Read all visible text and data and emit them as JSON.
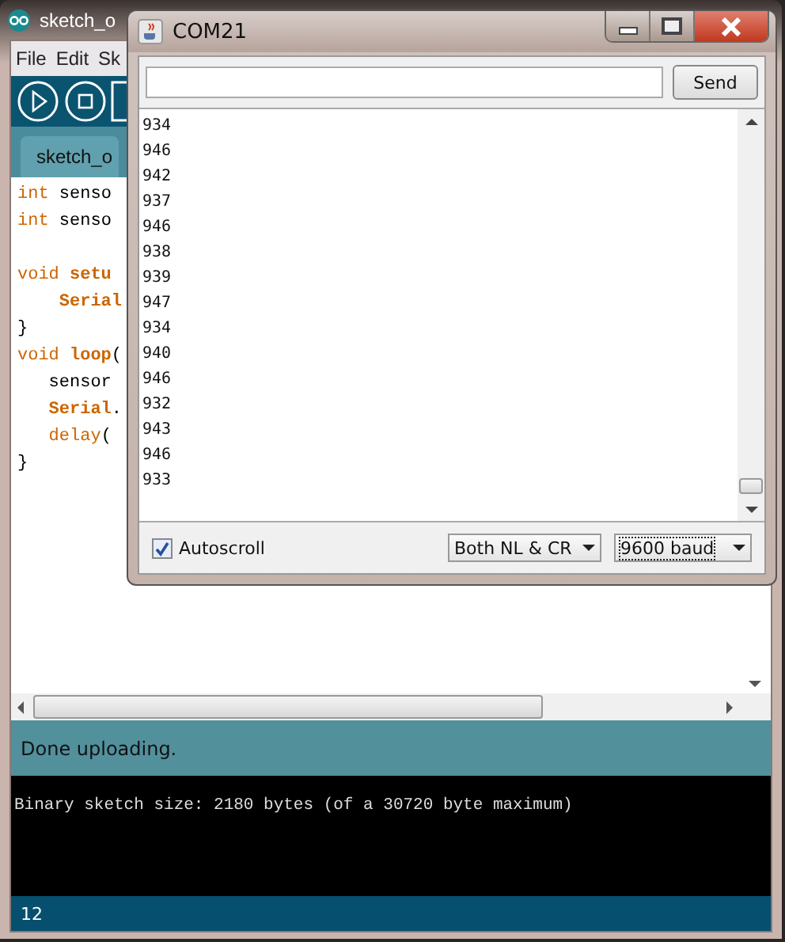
{
  "editor_window": {
    "title": "sketch_o",
    "menu": [
      {
        "label": "File"
      },
      {
        "label": "Edit"
      },
      {
        "label": "Sk"
      }
    ],
    "tab": {
      "label": "sketch_o"
    },
    "code_lines": [
      {
        "tokens": [
          {
            "kind": "keyword",
            "text": "int"
          },
          {
            "kind": "plain",
            "text": " senso"
          }
        ]
      },
      {
        "tokens": [
          {
            "kind": "keyword",
            "text": "int"
          },
          {
            "kind": "plain",
            "text": " senso"
          }
        ]
      },
      {
        "gap_before": true,
        "tokens": [
          {
            "kind": "keyword",
            "text": "void"
          },
          {
            "kind": "bold",
            "text": " setu"
          }
        ]
      },
      {
        "tokens": [
          {
            "kind": "bold",
            "text": "    Serial"
          }
        ]
      },
      {
        "tokens": [
          {
            "kind": "plain",
            "text": "}"
          }
        ]
      },
      {
        "tokens": [
          {
            "kind": "keyword",
            "text": "void"
          },
          {
            "kind": "bold",
            "text": " loop"
          },
          {
            "kind": "plain",
            "text": "("
          }
        ]
      },
      {
        "tokens": [
          {
            "kind": "plain",
            "text": "   sensor"
          }
        ]
      },
      {
        "tokens": [
          {
            "kind": "bold",
            "text": "   Serial"
          },
          {
            "kind": "plain",
            "text": "."
          }
        ]
      },
      {
        "tokens": [
          {
            "kind": "keyword",
            "text": "   delay"
          },
          {
            "kind": "plain",
            "text": "("
          }
        ]
      },
      {
        "tokens": [
          {
            "kind": "plain",
            "text": "}"
          }
        ]
      }
    ],
    "status": "Done uploading.",
    "console": "Binary sketch size: 2180 bytes (of a 30720 byte maximum)",
    "line_number": "12"
  },
  "serial_monitor": {
    "title": "COM21",
    "send_button": "Send",
    "output_lines": [
      "934",
      "946",
      "942",
      "937",
      "946",
      "938",
      "939",
      "947",
      "934",
      "940",
      "946",
      "932",
      "943",
      "946",
      "933"
    ],
    "autoscroll": {
      "label": "Autoscroll",
      "checked": true
    },
    "line_ending": "Both NL & CR",
    "baud_rate": "9600 baud"
  }
}
